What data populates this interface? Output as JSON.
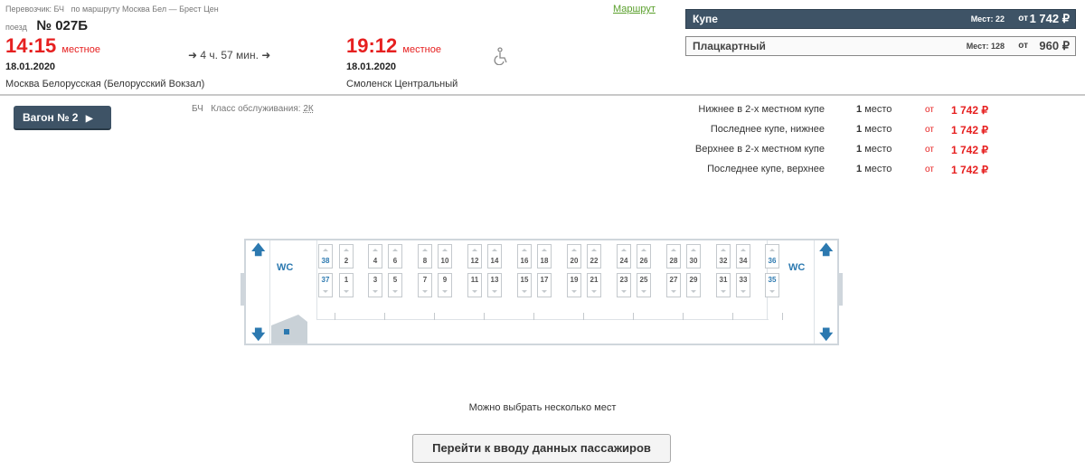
{
  "header": {
    "carrier_label": "Перевозчик: БЧ",
    "route_label": "по маршруту Москва Бел — Брест Цен",
    "train_prefix": "поезд",
    "train_number": "№ 027Б",
    "route_link": "Маршрут"
  },
  "departure": {
    "time": "14:15",
    "tz": "местное",
    "date": "18.01.2020",
    "station": "Москва Белорусская (Белорусский Вокзал)"
  },
  "duration": "4 ч. 57 мин.",
  "arrival": {
    "time": "19:12",
    "tz": "местное",
    "date": "18.01.2020",
    "station": "Смоленск Центральный"
  },
  "icons": {
    "accessibility": "wheelchair-icon",
    "arrow": "right-arrow-icon"
  },
  "classes": [
    {
      "name": "Купе",
      "seats_label": "Мест: 22",
      "ot": "от",
      "price": "1 742 ₽",
      "active": true
    },
    {
      "name": "Плацкартный",
      "seats_label": "Мест: 128",
      "ot": "от",
      "price": "960 ₽",
      "active": false
    }
  ],
  "wagon": {
    "button_label": "Вагон № 2",
    "carrier": "БЧ",
    "service_label": "Класс обслуживания:",
    "service_class": "2К"
  },
  "prices": [
    {
      "desc": "Нижнее в 2-х местном купе",
      "count_num": "1",
      "count_word": "место",
      "ot": "от",
      "price": "1 742 ₽"
    },
    {
      "desc": "Последнее купе, нижнее",
      "count_num": "1",
      "count_word": "место",
      "ot": "от",
      "price": "1 742 ₽"
    },
    {
      "desc": "Верхнее в 2-х местном купе",
      "count_num": "1",
      "count_word": "место",
      "ot": "от",
      "price": "1 742 ₽"
    },
    {
      "desc": "Последнее купе, верхнее",
      "count_num": "1",
      "count_word": "место",
      "ot": "от",
      "price": "1 742 ₽"
    }
  ],
  "car_map": {
    "wc_label": "WC",
    "upper_seats": [
      "38",
      "2",
      "4",
      "6",
      "8",
      "10",
      "12",
      "14",
      "16",
      "18",
      "20",
      "22",
      "24",
      "26",
      "28",
      "30",
      "32",
      "34",
      "36"
    ],
    "lower_seats": [
      "37",
      "1",
      "3",
      "5",
      "7",
      "9",
      "11",
      "13",
      "15",
      "17",
      "19",
      "21",
      "23",
      "25",
      "27",
      "29",
      "31",
      "33",
      "35"
    ],
    "free_seats": [
      "38",
      "37",
      "36",
      "35"
    ]
  },
  "footer": {
    "note": "Можно выбрать несколько мест",
    "next_button": "Перейти к вводу данных пассажиров"
  },
  "colors": {
    "accent": "#3e5366",
    "price": "#e62020",
    "link": "#2c79b0",
    "route_link": "#5aa02c"
  }
}
